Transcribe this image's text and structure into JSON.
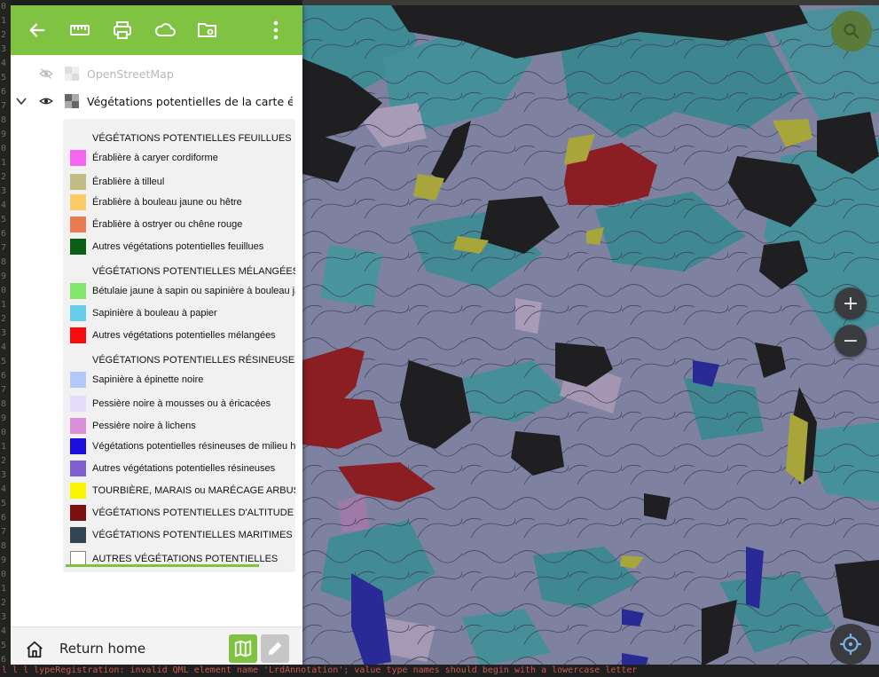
{
  "ide": {
    "line_numbers": [
      "0",
      "1",
      "2",
      "3",
      "4",
      "5",
      "6",
      "7",
      "8",
      "9",
      "0",
      "1",
      "2",
      "3",
      "4",
      "5",
      "6",
      "7",
      "8",
      "9",
      "0",
      "1",
      "2",
      "3",
      "4",
      "5",
      "6",
      "7",
      "8",
      "9",
      "0",
      "1",
      "2",
      "3",
      "4",
      "5",
      "6",
      "7",
      "8",
      "9",
      "0",
      "1",
      "2",
      "3",
      "4",
      "5",
      "6"
    ],
    "bottom_text": "l  l  l   lypeRegistration: invalid QML element name 'LrdAnnotation'; value type names should begin with a lowercase letter"
  },
  "toolbar": {
    "back_icon": "arrow-left-icon",
    "measure_icon": "ruler-icon",
    "print_icon": "printer-icon",
    "cloud_icon": "cloud-icon",
    "project_folder_icon": "folder-settings-icon",
    "menu_icon": "kebab-menu-icon",
    "color": "#80c342"
  },
  "layers": [
    {
      "name": "OpenStreetMap",
      "visible": false,
      "expanded": false
    },
    {
      "name": "Végétations potentielles de la carte éc...",
      "visible": true,
      "expanded": true
    }
  ],
  "legend": {
    "sections": [
      {
        "header": "VÉGÉTATIONS POTENTIELLES FEUILLUES",
        "items": [
          {
            "label": "Érablière à caryer cordiforme",
            "color": "#f466f0"
          },
          {
            "label": "Érablière à tilleul",
            "color": "#c3bd85"
          },
          {
            "label": "Érablière à bouleau jaune ou hêtre",
            "color": "#fdcb65"
          },
          {
            "label": "Érablière à ostryer ou chêne rouge",
            "color": "#ea7b51"
          },
          {
            "label": "Autres végétations potentielles feuillues",
            "color": "#0b5e14"
          }
        ]
      },
      {
        "header": "VÉGÉTATIONS POTENTIELLES MÉLANGÉES",
        "items": [
          {
            "label": "Bétulaie jaune à sapin ou sapinière à bouleau jaune",
            "color": "#82e86d"
          },
          {
            "label": "Sapinière à bouleau à papier",
            "color": "#68cde8"
          },
          {
            "label": "Autres végétations potentielles mélangées",
            "color": "#f60c0c"
          }
        ]
      },
      {
        "header": "VÉGÉTATIONS POTENTIELLES RÉSINEUSES",
        "items": [
          {
            "label": "Sapinière à épinette noire",
            "color": "#b2c8f9"
          },
          {
            "label": "Pessière noire à mousses ou à éricacées",
            "color": "#e4dcfa"
          },
          {
            "label": "Pessière noire à lichens",
            "color": "#dc8fd9"
          },
          {
            "label": "Végétations potentielles résineuses de milieu humide",
            "color": "#1c0fde"
          },
          {
            "label": "Autres végétations potentielles résineuses",
            "color": "#8060d0"
          }
        ]
      }
    ],
    "standalone": [
      {
        "label": "TOURBIÈRE, MARAIS ou MARÉCAGE ARBUSTIF",
        "color": "#faf502"
      },
      {
        "label": "VÉGÉTATIONS POTENTIELLES D'ALTITUDE",
        "color": "#7c0f10"
      },
      {
        "label": "VÉGÉTATIONS POTENTIELLES MARITIMES",
        "color": "#344451"
      },
      {
        "label": "AUTRES VÉGÉTATIONS POTENTIELLES",
        "color": "#ffffff"
      }
    ]
  },
  "bottom": {
    "home_label": "Return home",
    "home_icon": "home-icon",
    "map_mode_icon": "map-icon",
    "edit_mode_icon": "pencil-icon"
  },
  "map_controls": {
    "search_icon": "search-icon",
    "zoom_in": "+",
    "zoom_out": "−",
    "locate_icon": "gps-target-icon"
  }
}
